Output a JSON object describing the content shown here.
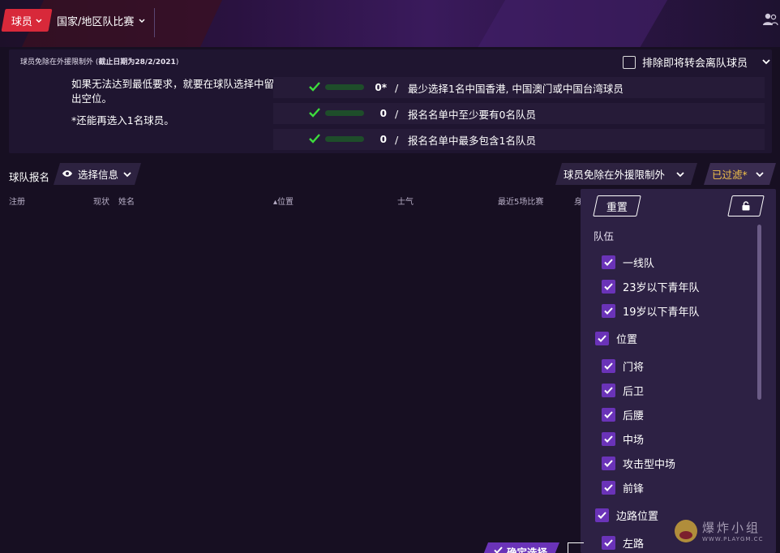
{
  "header": {
    "tab_player": "球员",
    "tab_national": "国家/地区队比赛"
  },
  "requirements": {
    "title_prefix": "球员免除在外援限制外 (",
    "title_date_label": "截止日期为",
    "title_date": "28/2/2021",
    "title_suffix": ")",
    "note_primary": "如果无法达到最低要求，就要在球队选择中留出空位。",
    "note_secondary": "*还能再选入1名球员。",
    "exclude_label": "排除即将转会离队球员",
    "rows": [
      {
        "count": "0*",
        "slash": "/",
        "text": "最少选择1名中国香港, 中国澳门或中国台湾球员"
      },
      {
        "count": "0",
        "slash": "/",
        "text": "报名名单中至少要有0名队员"
      },
      {
        "count": "0",
        "slash": "/",
        "text": "报名名单中最多包含1名队员"
      }
    ]
  },
  "toolbar": {
    "squad_label": "球队报名",
    "select_info": "选择信息",
    "exempt_label": "球员免除在外援限制外",
    "filtered_label": "已过滤*"
  },
  "columns": {
    "register": "注册",
    "status": "现状",
    "name": "姓名",
    "position": "▴位置",
    "morale": "士气",
    "last5": "最近5场比赛",
    "partial": "身"
  },
  "filter": {
    "reset": "重置",
    "group_team": "队伍",
    "team_items": [
      "一线队",
      "23岁以下青年队",
      "19岁以下青年队"
    ],
    "position_label": "位置",
    "position_items": [
      "门将",
      "后卫",
      "后腰",
      "中场",
      "攻击型中场",
      "前锋"
    ],
    "wing_label": "边路位置",
    "wing_items": [
      "左路"
    ]
  },
  "footer": {
    "confirm": "确定选择"
  },
  "watermark": {
    "text": "爆炸小组",
    "url": "WWW.PLAYGM.CC"
  },
  "colors": {
    "accent_red": "#d8293a",
    "accent_purple": "#6a33b8",
    "check_green": "#3ddc3d",
    "filter_yellow": "#f2c24a"
  }
}
